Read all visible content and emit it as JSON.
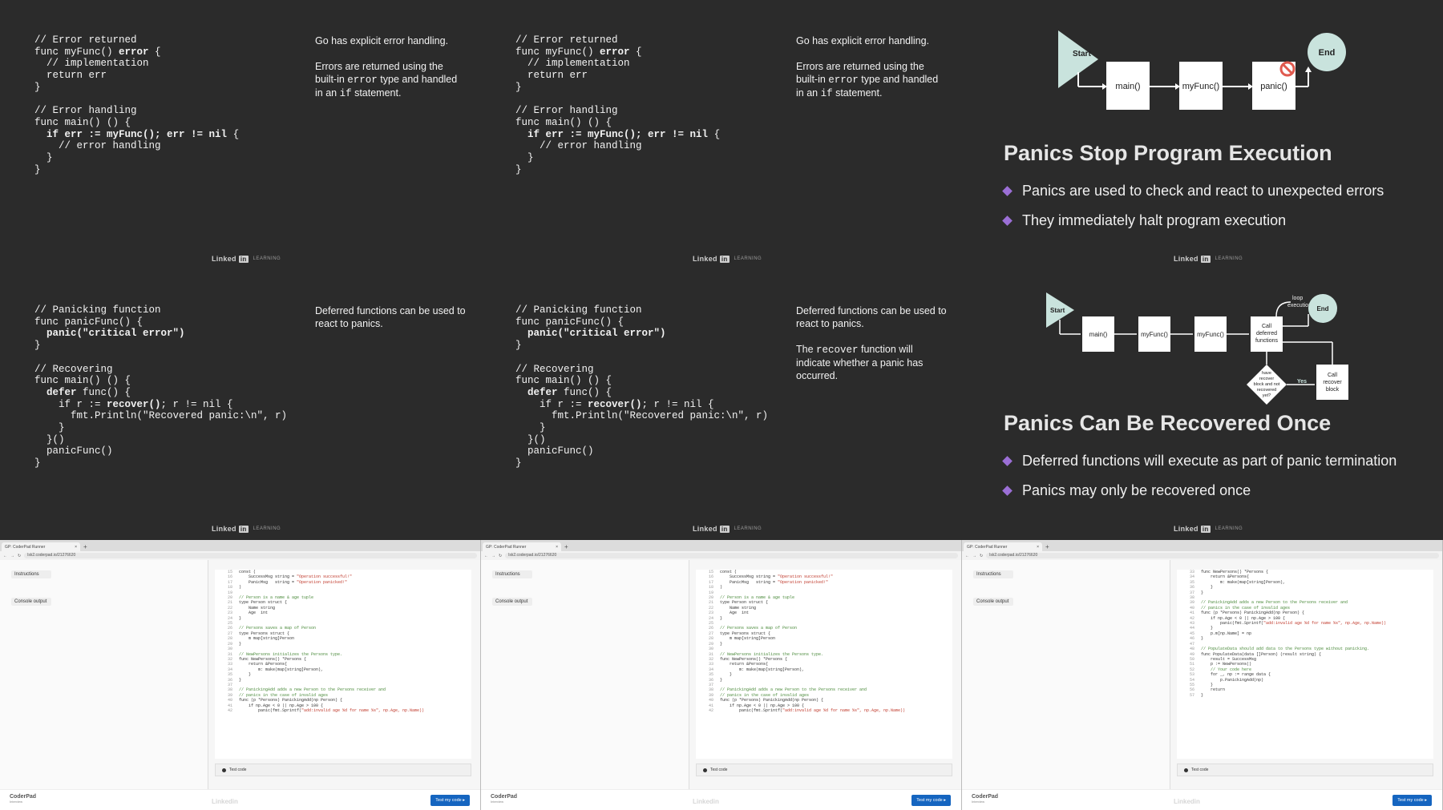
{
  "linkedin": {
    "brand": "Linked",
    "in": "in",
    "sub": "LEARNING"
  },
  "slide1": {
    "code": [
      {
        "t": "// Error returned"
      },
      {
        "t": "func myFunc() ",
        "b": "error",
        "r": " {"
      },
      {
        "t": "  // implementation"
      },
      {
        "t": "  return err"
      },
      {
        "t": "}"
      },
      {
        "t": ""
      },
      {
        "t": "// Error handling"
      },
      {
        "t": "func main() () {"
      },
      {
        "t": "  ",
        "b": "if err := myFunc(); err != nil",
        "r": " {"
      },
      {
        "t": "    // error handling"
      },
      {
        "t": "  }"
      },
      {
        "t": "}"
      }
    ],
    "note1": "Go has explicit error handling.",
    "note2a": "Errors are returned using the built-in ",
    "note2b": "error",
    "note2c": " type and handled in an ",
    "note2d": "if",
    "note2e": " statement."
  },
  "slide3": {
    "title": "Panics Stop Program Execution",
    "bullets": [
      "Panics are used to check and react to unexpected errors",
      "They immediately halt program execution"
    ],
    "diagram": {
      "start": "Start",
      "end": "End",
      "boxes": [
        "main()",
        "myFunc()",
        "panic()"
      ]
    }
  },
  "slide4": {
    "code": [
      {
        "t": "// Panicking function"
      },
      {
        "t": "func panicFunc() {"
      },
      {
        "t": "  ",
        "b": "panic(\"critical error\")"
      },
      {
        "t": "}"
      },
      {
        "t": ""
      },
      {
        "t": "// Recovering"
      },
      {
        "t": "func main() () {"
      },
      {
        "t": "  ",
        "b": "defer",
        "r": " func() {"
      },
      {
        "t": "    if r := ",
        "b": "recover()",
        "r": "; r != nil {"
      },
      {
        "t": "      fmt.Println(\"Recovered panic:\\n\", r)"
      },
      {
        "t": "    }"
      },
      {
        "t": "  }()"
      },
      {
        "t": "  panicFunc()"
      },
      {
        "t": "}"
      }
    ],
    "note1": "Deferred functions can be used to react to panics.",
    "note2a": "The ",
    "note2b": "recover",
    "note2c": " function will indicate whether a panic has occurred."
  },
  "slide6": {
    "title": "Panics Can Be Recovered Once",
    "bullets": [
      "Deferred functions will execute as part of panic termination",
      "Panics may only be recovered once"
    ],
    "diagram": {
      "start": "Start",
      "end": "End",
      "boxes": [
        "main()",
        "myFunc()",
        "myFunc()"
      ],
      "call_deferred": [
        "Call",
        "deferred",
        "functions"
      ],
      "loop": [
        "loop",
        "execution"
      ],
      "decision": [
        "have",
        "recover",
        "block and not",
        "recovered",
        "yet?"
      ],
      "yes": "Yes",
      "recover_block": [
        "Call",
        "recover",
        "block"
      ]
    }
  },
  "browser": {
    "tab_title": "GP: CoderPad Runner",
    "url": "lsk2.coderpad.io/21276620",
    "instructions": "Instructions",
    "console": "Console output",
    "test_code": "Test code",
    "coderpad": "CoderPad",
    "coderpad_sub": "Interview",
    "test_btn": "Test my code ▸",
    "code_a": [
      [
        "15",
        "const (",
        ""
      ],
      [
        "16",
        "    SuccessMsg string = ",
        "\"Operation successful!\""
      ],
      [
        "17",
        "    PanicMsg   string = ",
        "\"Operation panicked!\""
      ],
      [
        "18",
        ")",
        ""
      ],
      [
        "19",
        "",
        ""
      ],
      [
        "20",
        "// Person is a name & age tuple",
        "c"
      ],
      [
        "21",
        "type Person struct {",
        ""
      ],
      [
        "22",
        "    Name string",
        ""
      ],
      [
        "23",
        "    Age  int",
        ""
      ],
      [
        "24",
        "}",
        ""
      ],
      [
        "25",
        "",
        ""
      ],
      [
        "26",
        "// Persons saves a map of Person",
        "c"
      ],
      [
        "27",
        "type Persons struct {",
        ""
      ],
      [
        "28",
        "    m map[string]Person",
        ""
      ],
      [
        "29",
        "}",
        ""
      ],
      [
        "30",
        "",
        ""
      ],
      [
        "31",
        "// NewPersons initializes the Persons type.",
        "c"
      ],
      [
        "32",
        "func NewPersons() *Persons {",
        ""
      ],
      [
        "33",
        "    return &Persons{",
        ""
      ],
      [
        "34",
        "        m: make(map[string]Person),",
        ""
      ],
      [
        "35",
        "    }",
        ""
      ],
      [
        "36",
        "}",
        ""
      ],
      [
        "37",
        "",
        ""
      ],
      [
        "38",
        "// PanickingAdd adds a new Person to the Persons receiver and",
        "c"
      ],
      [
        "39",
        "// panics in the case of invalid ages",
        "c"
      ],
      [
        "40",
        "func (p *Persons) PanickingAdd(np Person) {",
        ""
      ],
      [
        "41",
        "    if np.Age < 0 || np.Age > 100 {",
        ""
      ],
      [
        "42",
        "        panic(fmt.Sprintf(",
        "\"add:invalid age %d for name %s\", np.Age, np.Name))"
      ]
    ],
    "code_b": [
      [
        "33",
        "func NewPersons() *Persons {",
        ""
      ],
      [
        "34",
        "    return &Persons{",
        ""
      ],
      [
        "35",
        "        m: make(map[string]Person),",
        ""
      ],
      [
        "36",
        "    }",
        ""
      ],
      [
        "37",
        "}",
        ""
      ],
      [
        "38",
        "",
        ""
      ],
      [
        "39",
        "// PanickingAdd adds a new Person to the Persons receiver and",
        "c"
      ],
      [
        "40",
        "// panics in the case of invalid ages",
        "c"
      ],
      [
        "41",
        "func (p *Persons) PanickingAdd(np Person) {",
        ""
      ],
      [
        "42",
        "    if np.Age < 0 || np.Age > 100 {",
        ""
      ],
      [
        "43",
        "        panic(fmt.Sprintf(",
        "\"add:invalid age %d for name %s\", np.Age, np.Name))"
      ],
      [
        "44",
        "    }",
        ""
      ],
      [
        "45",
        "    p.m[np.Name] = np",
        ""
      ],
      [
        "46",
        "}",
        ""
      ],
      [
        "47",
        "",
        ""
      ],
      [
        "48",
        "// PopulateData should add data to the Persons type without panicking.",
        "c"
      ],
      [
        "49",
        "func PopulateData(data []Person) (result string) {",
        ""
      ],
      [
        "50",
        "    result = SuccessMsg",
        ""
      ],
      [
        "51",
        "    p := NewPersons()",
        ""
      ],
      [
        "52",
        "    // Your code here",
        "c"
      ],
      [
        "53",
        "    for _, np := range data {",
        ""
      ],
      [
        "54",
        "        p.PanickingAdd(np)",
        ""
      ],
      [
        "55",
        "    }",
        ""
      ],
      [
        "56",
        "    return",
        ""
      ],
      [
        "57",
        "}",
        ""
      ]
    ]
  }
}
